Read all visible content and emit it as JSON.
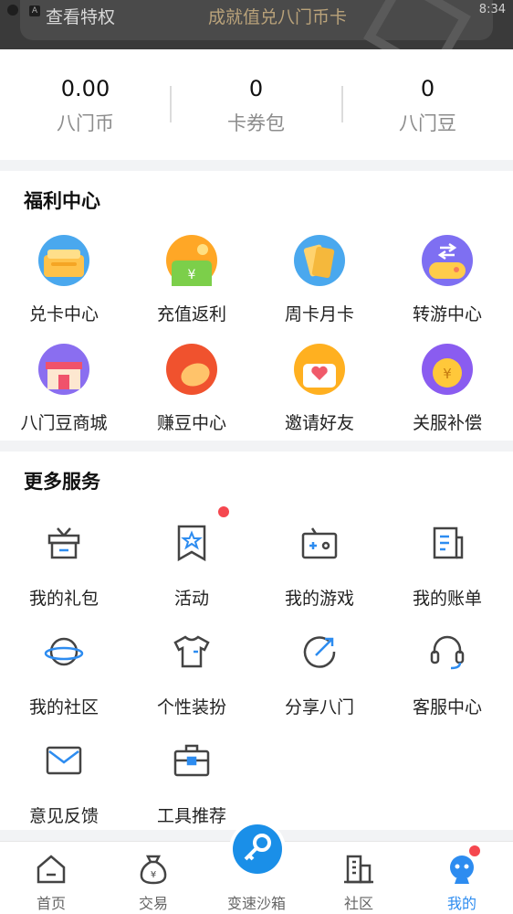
{
  "banner": {
    "left_text": "查看特权",
    "center_text": "成就值兑八门币卡",
    "time": "8:34"
  },
  "stats": [
    {
      "value": "0.00",
      "label": "八门币"
    },
    {
      "value": "0",
      "label": "卡券包"
    },
    {
      "value": "0",
      "label": "八门豆"
    }
  ],
  "welfare": {
    "title": "福利中心",
    "items": [
      {
        "label": "兑卡中心",
        "icon": "card-exchange-icon"
      },
      {
        "label": "充值返利",
        "icon": "recharge-rebate-icon"
      },
      {
        "label": "周卡月卡",
        "icon": "weekly-monthly-card-icon"
      },
      {
        "label": "转游中心",
        "icon": "game-transfer-icon"
      },
      {
        "label": "八门豆商城",
        "icon": "bean-mall-icon"
      },
      {
        "label": "赚豆中心",
        "icon": "earn-beans-icon"
      },
      {
        "label": "邀请好友",
        "icon": "invite-friends-icon"
      },
      {
        "label": "关服补偿",
        "icon": "server-close-compensation-icon"
      }
    ]
  },
  "services": {
    "title": "更多服务",
    "items": [
      {
        "label": "我的礼包",
        "icon": "gift-icon"
      },
      {
        "label": "活动",
        "icon": "activity-star-icon"
      },
      {
        "label": "我的游戏",
        "icon": "game-controller-icon"
      },
      {
        "label": "我的账单",
        "icon": "bill-icon"
      },
      {
        "label": "我的社区",
        "icon": "planet-icon"
      },
      {
        "label": "个性装扮",
        "icon": "tshirt-icon"
      },
      {
        "label": "分享八门",
        "icon": "share-arrow-icon"
      },
      {
        "label": "客服中心",
        "icon": "headset-icon"
      },
      {
        "label": "意见反馈",
        "icon": "mail-icon"
      },
      {
        "label": "工具推荐",
        "icon": "toolbox-icon"
      }
    ]
  },
  "tabbar": [
    {
      "label": "首页",
      "icon": "home-icon"
    },
    {
      "label": "交易",
      "icon": "money-bag-icon"
    },
    {
      "label": "变速沙箱",
      "icon": "key-icon"
    },
    {
      "label": "社区",
      "icon": "buildings-icon"
    },
    {
      "label": "我的",
      "icon": "profile-mascot-icon"
    }
  ],
  "colors": {
    "accent": "#2d8cf0",
    "badge": "#f5474f"
  }
}
